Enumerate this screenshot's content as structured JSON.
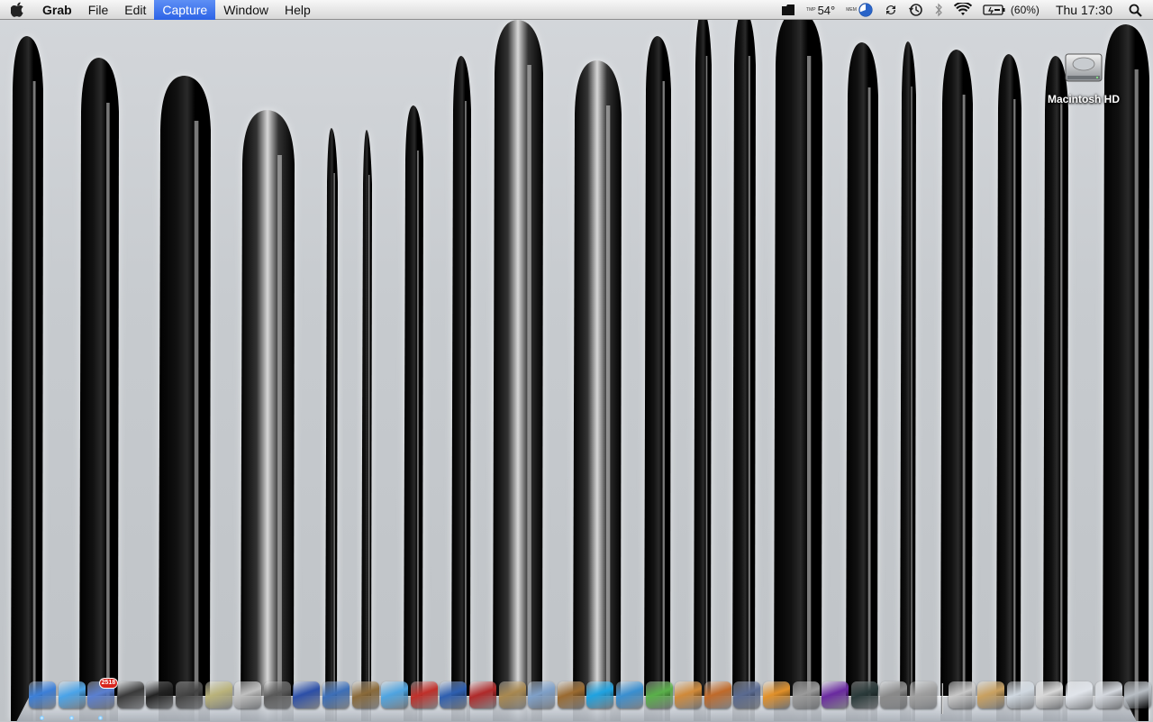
{
  "menubar": {
    "app_name": "Grab",
    "menus": [
      "File",
      "Edit",
      "Capture",
      "Window",
      "Help"
    ],
    "active_menu": "Capture",
    "status": {
      "temp_label": "TMP",
      "temp_value": "54°",
      "mem_label": "MEM",
      "battery_text": "(60%)",
      "clock": "Thu 17:30"
    }
  },
  "desktop": {
    "drive_label": "Macintosh HD"
  },
  "dock": {
    "badge_count": "2518",
    "items": [
      {
        "name": "finder-icon",
        "color": "#3c7fd8",
        "running": true
      },
      {
        "name": "safari-icon",
        "color": "#4aa3e8",
        "running": true
      },
      {
        "name": "preview-icon",
        "color": "#5a7fd0",
        "running": true
      },
      {
        "name": "camera-app-icon",
        "color": "#3a3a3a",
        "running": false
      },
      {
        "name": "aperture-icon",
        "color": "#222222",
        "running": false
      },
      {
        "name": "photo-camera-icon",
        "color": "#444444",
        "running": false
      },
      {
        "name": "star-app-icon",
        "color": "#b9b27a",
        "running": false
      },
      {
        "name": "photo-booth-icon",
        "color": "#c0c0c0",
        "running": false
      },
      {
        "name": "imovie-icon",
        "color": "#5a5a5a",
        "running": false
      },
      {
        "name": "text-editor-icon",
        "color": "#2c4fa8",
        "running": false
      },
      {
        "name": "xcode-icon",
        "color": "#3d6fb8",
        "running": false
      },
      {
        "name": "iphoto-icon",
        "color": "#8a6a3a",
        "running": false
      },
      {
        "name": "itunes-icon",
        "color": "#4fa4e0",
        "running": false
      },
      {
        "name": "miro-icon",
        "color": "#c0302a",
        "running": false
      },
      {
        "name": "google-earth-icon",
        "color": "#2e5fb0",
        "running": false
      },
      {
        "name": "photo-stack-icon",
        "color": "#b02a2a",
        "running": false
      },
      {
        "name": "frame-app-icon",
        "color": "#a88850",
        "running": false
      },
      {
        "name": "slideshow-icon",
        "color": "#7fa0c8",
        "running": false
      },
      {
        "name": "garageband-icon",
        "color": "#9a6a30",
        "running": false
      },
      {
        "name": "skype-icon",
        "color": "#1fa2e0",
        "running": false
      },
      {
        "name": "wordpress-icon",
        "color": "#3a8fd0",
        "running": false
      },
      {
        "name": "puzzle-icon",
        "color": "#5ab04a",
        "running": false
      },
      {
        "name": "growl-icon",
        "color": "#d08a3a",
        "running": false
      },
      {
        "name": "presentation-icon",
        "color": "#c06a2a",
        "running": false
      },
      {
        "name": "pen-app-icon",
        "color": "#5a6a90",
        "running": false
      },
      {
        "name": "half-life-icon",
        "color": "#e0902a",
        "running": false
      },
      {
        "name": "script-icon",
        "color": "#9a9a9a",
        "running": false
      },
      {
        "name": "purple-app-icon",
        "color": "#6a2aa0",
        "running": false
      },
      {
        "name": "activity-monitor-icon",
        "color": "#2a3a3a",
        "running": false
      },
      {
        "name": "system-preferences-icon",
        "color": "#8a8a8a",
        "running": false
      },
      {
        "name": "utility-icon",
        "color": "#a0a0a0",
        "running": false
      },
      {
        "name": "documents-stack-icon",
        "color": "#c8c8c8",
        "running": false
      },
      {
        "name": "mail-stamp-icon",
        "color": "#c8a060",
        "running": false
      },
      {
        "name": "window-thumb-icon",
        "color": "#d0d8e0",
        "running": false
      },
      {
        "name": "ruler-doc-icon",
        "color": "#d8d8d8",
        "running": false
      },
      {
        "name": "screenshot-thumb-icon",
        "color": "#e0e4ea",
        "running": false
      },
      {
        "name": "screenshot-thumb-2-icon",
        "color": "#d4d8de",
        "running": false
      },
      {
        "name": "trash-icon",
        "color": "#b8bec4",
        "running": false
      }
    ]
  }
}
